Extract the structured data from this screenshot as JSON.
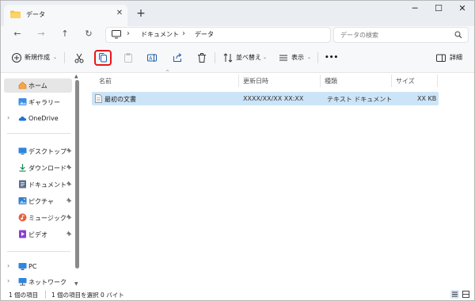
{
  "tab": {
    "title": "データ"
  },
  "window": {
    "minimize": "─",
    "maximize": "☐",
    "close": "✕"
  },
  "nav": {
    "back": "←",
    "forward": "→",
    "up": "↑",
    "refresh": "↻"
  },
  "breadcrumb": {
    "items": [
      "ドキュメント",
      "データ"
    ],
    "separator": "›"
  },
  "search": {
    "placeholder": "データの検索"
  },
  "toolbar": {
    "new_label": "新規作成",
    "sort_label": "並べ替え",
    "view_label": "表示",
    "more": "•••",
    "details_label": "詳細"
  },
  "sidebar": {
    "home": "ホーム",
    "gallery": "ギャラリー",
    "onedrive": "OneDrive",
    "desktop": "デスクトップ",
    "downloads": "ダウンロード",
    "documents": "ドキュメント",
    "pictures": "ピクチャ",
    "music": "ミュージック",
    "videos": "ビデオ",
    "pc": "PC",
    "network": "ネットワーク"
  },
  "columns": {
    "name": "名前",
    "modified": "更新日時",
    "type": "種類",
    "size": "サイズ"
  },
  "files": [
    {
      "name": "最初の文書",
      "modified": "XXXX/XX/XX XX:XX",
      "type": "テキスト ドキュメント",
      "size": "XX KB"
    }
  ],
  "status": {
    "item_count": "1 個の項目",
    "selected": "1 個の項目を選択 0 バイト"
  },
  "colors": {
    "accent": "#0067c0",
    "selection": "#cce4f7",
    "highlight_box": "#e8161b",
    "folder": "#f4c242"
  }
}
